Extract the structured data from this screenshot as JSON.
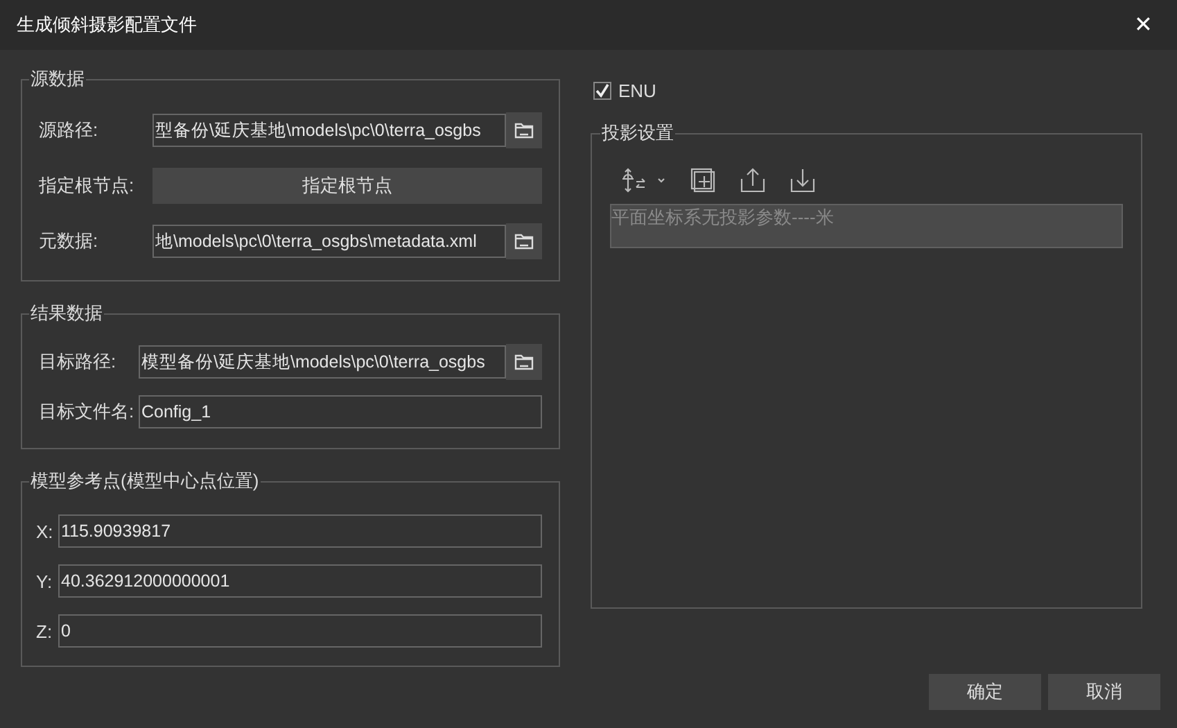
{
  "window": {
    "title": "生成倾斜摄影配置文件",
    "close": "✕"
  },
  "source_group": {
    "title": "源数据",
    "rows": [
      {
        "kind": "path",
        "label": "源路径:",
        "value": "型备份\\延庆基地\\models\\pc\\0\\terra_osgbs"
      },
      {
        "kind": "button",
        "label": "指定根节点:",
        "value": "指定根节点"
      },
      {
        "kind": "path",
        "label": "元数据:",
        "value": "地\\models\\pc\\0\\terra_osgbs\\metadata.xml"
      }
    ]
  },
  "result_group": {
    "title": "结果数据",
    "rows": [
      {
        "kind": "path",
        "label": "目标路径:",
        "value": "模型备份\\延庆基地\\models\\pc\\0\\terra_osgbs"
      },
      {
        "kind": "text",
        "label": "目标文件名:",
        "value": "Config_1"
      }
    ]
  },
  "reference_group": {
    "title": "模型参考点(模型中心点位置)",
    "rows": [
      {
        "label": "X:",
        "value": "115.90939817"
      },
      {
        "label": "Y:",
        "value": "40.362912000000001"
      },
      {
        "label": "Z:",
        "value": "0"
      }
    ]
  },
  "enu": {
    "label": "ENU",
    "checked": true
  },
  "projection_group": {
    "title": "投影设置",
    "placeholder": "平面坐标系无投影参数----米"
  },
  "buttons": [
    "确定",
    "取消"
  ]
}
